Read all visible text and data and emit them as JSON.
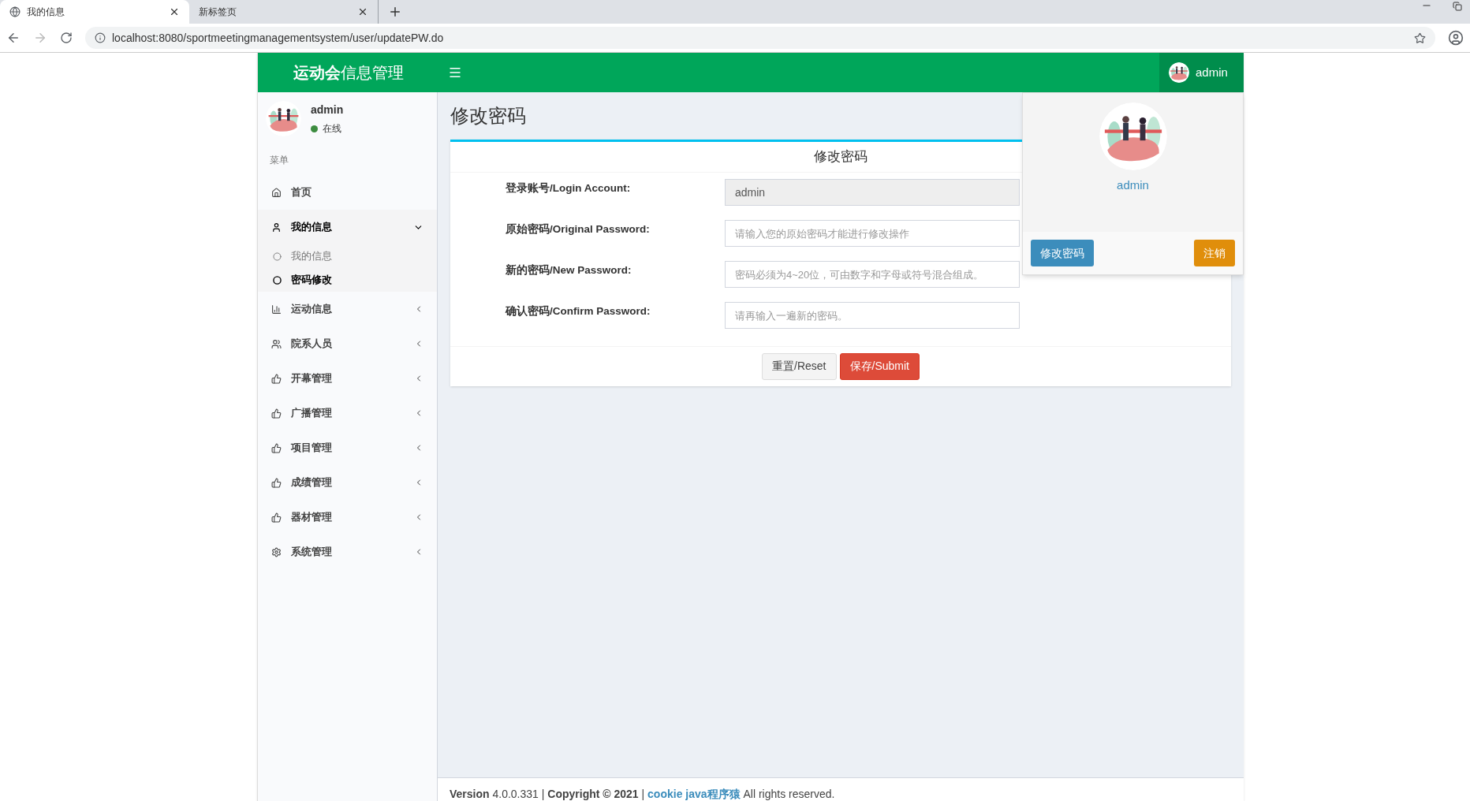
{
  "browser": {
    "tabs": [
      {
        "title": "我的信息",
        "selected": true
      },
      {
        "title": "新标签页",
        "selected": false
      }
    ],
    "address": "localhost:8080/sportmeetingmanagementsystem/user/updatePW.do"
  },
  "header": {
    "logo_bold": "运动会",
    "logo_rest": "信息管理",
    "user": "admin"
  },
  "sidebar": {
    "user": {
      "name": "admin",
      "status": "在线"
    },
    "menu_header": "菜单",
    "items": [
      {
        "label": "首页",
        "kind": "link"
      },
      {
        "label": "我的信息",
        "kind": "tree",
        "expanded": true,
        "children": [
          {
            "label": "我的信息",
            "selected": false
          },
          {
            "label": "密码修改",
            "selected": true
          }
        ]
      },
      {
        "label": "运动信息",
        "kind": "tree",
        "expanded": false
      },
      {
        "label": "院系人员",
        "kind": "tree",
        "expanded": false
      },
      {
        "label": "开幕管理",
        "kind": "tree",
        "expanded": false
      },
      {
        "label": "广播管理",
        "kind": "tree",
        "expanded": false
      },
      {
        "label": "项目管理",
        "kind": "tree",
        "expanded": false
      },
      {
        "label": "成绩管理",
        "kind": "tree",
        "expanded": false
      },
      {
        "label": "器材管理",
        "kind": "tree",
        "expanded": false
      },
      {
        "label": "系统管理",
        "kind": "tree",
        "expanded": false
      }
    ]
  },
  "content": {
    "title": "修改密码",
    "form": {
      "title": "修改密码",
      "fields": [
        {
          "label": "登录账号/Login Account:",
          "value": "admin",
          "disabled": true
        },
        {
          "label": "原始密码/Original Password:",
          "placeholder": "请输入您的原始密码才能进行修改操作",
          "disabled": false
        },
        {
          "label": "新的密码/New Password:",
          "placeholder": "密码必须为4~20位，可由数字和字母或符号混合组成。",
          "disabled": false
        },
        {
          "label": "确认密码/Confirm Password:",
          "placeholder": "请再输入一遍新的密码。",
          "disabled": false
        }
      ],
      "buttons": [
        {
          "label": "重置/Reset",
          "kind": "default"
        },
        {
          "label": "保存/Submit",
          "kind": "danger"
        }
      ]
    }
  },
  "user_menu": {
    "name": "admin",
    "buttons": [
      {
        "label": "修改密码",
        "kind": "primary"
      },
      {
        "label": "注销",
        "kind": "warning"
      }
    ]
  },
  "footer": {
    "before": "**Version** 4.0.0.331 | **Copyright © 2021** |",
    "link": "cookie java程序猿",
    "after": "All rights reserved."
  }
}
